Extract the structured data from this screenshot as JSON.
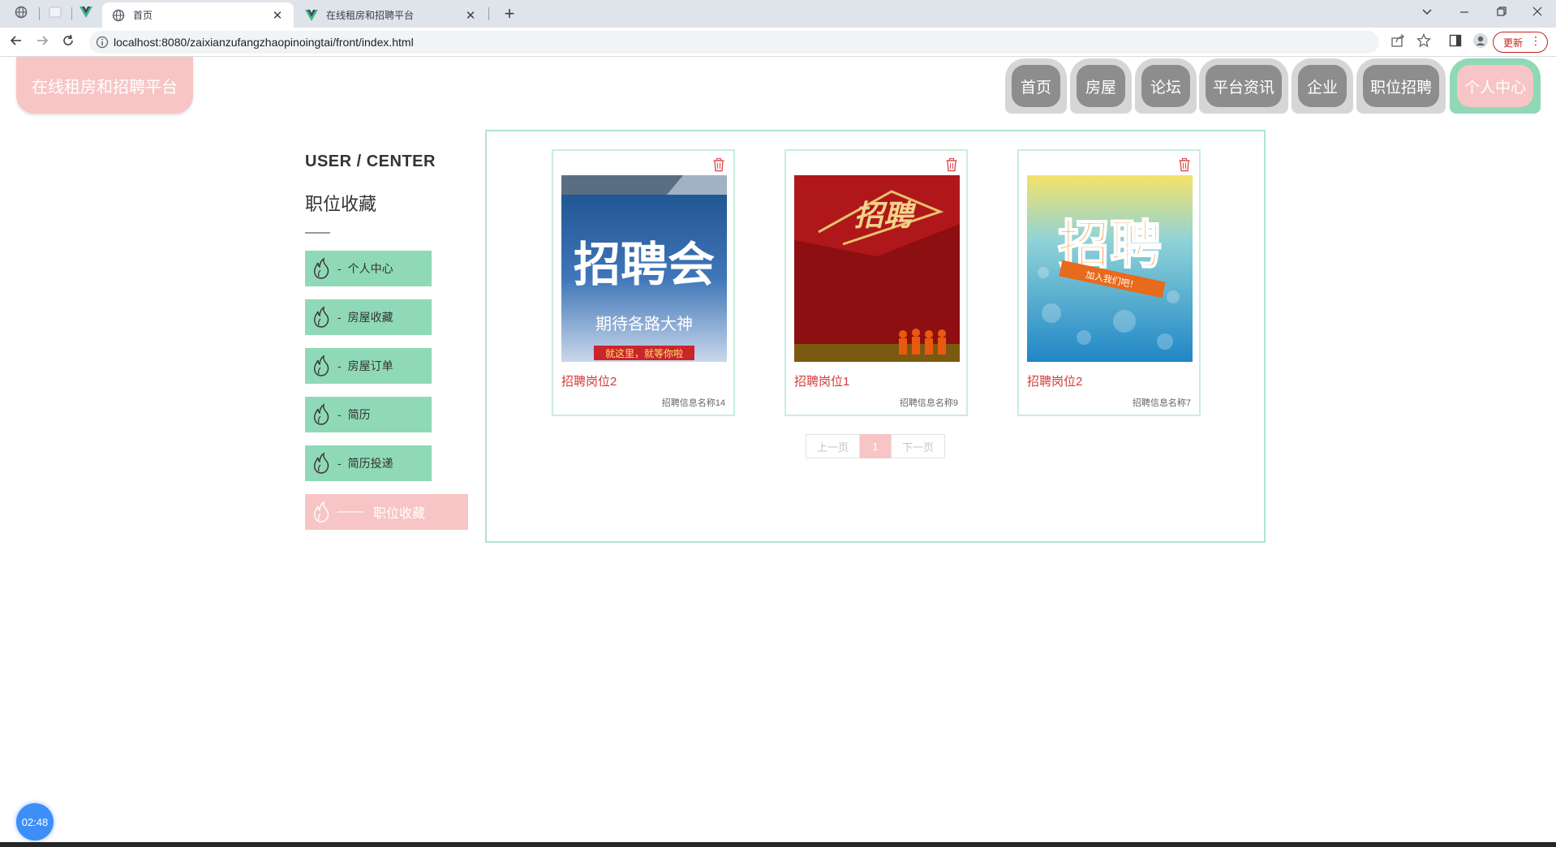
{
  "browser": {
    "tabs": [
      {
        "title": "首页",
        "active": true
      },
      {
        "title": "在线租房和招聘平台",
        "active": false
      }
    ],
    "url": "localhost:8080/zaixianzufangzhaopinoingtai/front/index.html",
    "update_label": "更新"
  },
  "site": {
    "logo": "在线租房和招聘平台",
    "nav": [
      "首页",
      "房屋",
      "论坛",
      "平台资讯",
      "企业",
      "职位招聘",
      "个人中心"
    ]
  },
  "sidebar": {
    "title": "USER / CENTER",
    "subtitle": "职位收藏",
    "items": [
      {
        "label": "个人中心"
      },
      {
        "label": "房屋收藏"
      },
      {
        "label": "房屋订单"
      },
      {
        "label": "简历"
      },
      {
        "label": "简历投递"
      },
      {
        "label": "职位收藏"
      }
    ],
    "dash": "-",
    "active_dash": "——"
  },
  "cards": [
    {
      "title": "招聘岗位2",
      "subtitle": "招聘信息名称14",
      "image_text": "招聘会",
      "image_caption": "期待各路大神",
      "image_banner": "就这里，就等你啦"
    },
    {
      "title": "招聘岗位1",
      "subtitle": "招聘信息名称9",
      "image_text": "招聘"
    },
    {
      "title": "招聘岗位2",
      "subtitle": "招聘信息名称7",
      "image_text": "招聘",
      "image_caption": "加入我们吧！"
    }
  ],
  "pager": {
    "prev": "上一页",
    "current": "1",
    "next": "下一页"
  },
  "timer": "02:48",
  "colors": {
    "accent_green": "#8fd9b6",
    "accent_pink": "#f7c5c5",
    "nav_gray": "#8d8d8d",
    "title_red": "#d4393a"
  }
}
